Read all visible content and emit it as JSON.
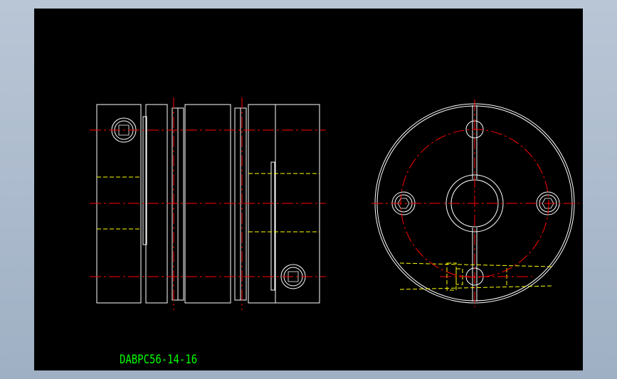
{
  "drawing": {
    "title": "DABPC56-14-16"
  },
  "colors": {
    "background": "#000000",
    "outline": "#ffffff",
    "centerline": "#ff0000",
    "hidden_line": "#ffff00",
    "title_text": "#00ff00",
    "frame": "#a9b8ca"
  }
}
